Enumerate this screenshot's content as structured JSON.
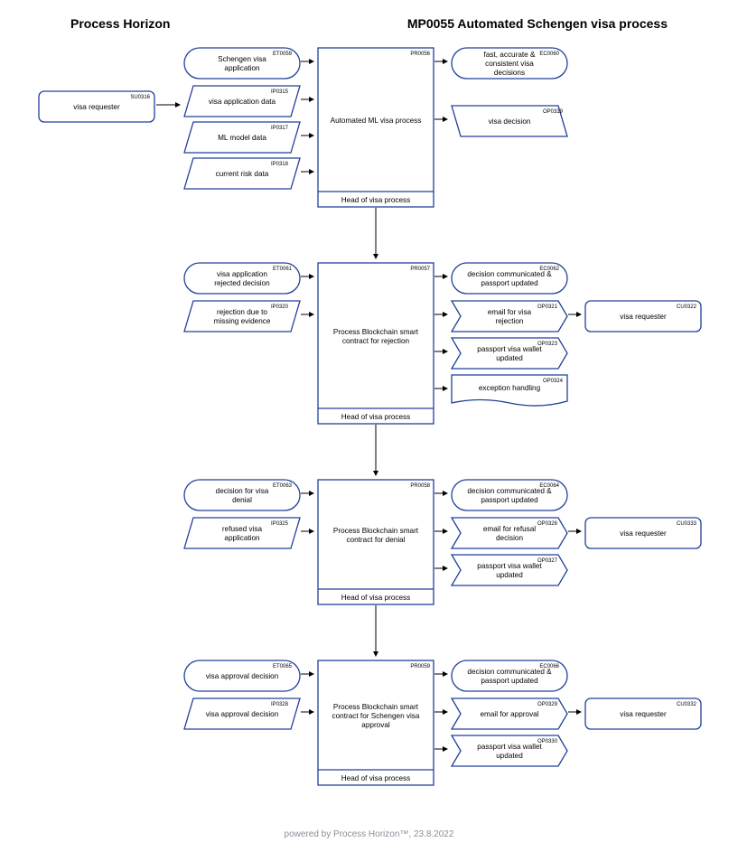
{
  "header": {
    "left": "Process Horizon",
    "right": "MP0055 Automated Schengen visa process"
  },
  "footer": "powered by Process Horizon™, 23.8.2022",
  "nodes": {
    "SU0316": {
      "code": "SU0316",
      "label": "visa requester"
    },
    "ET0059": {
      "code": "ET0059",
      "label": "Schengen visa application"
    },
    "IP0315": {
      "code": "IP0315",
      "label": "visa application data"
    },
    "IP0317": {
      "code": "IP0317",
      "label": "ML model data"
    },
    "IP0318": {
      "code": "IP0318",
      "label": "current risk data"
    },
    "PR0056": {
      "code": "PR0056",
      "label": "Automated ML visa process",
      "owner": "Head of visa process"
    },
    "EC0060": {
      "code": "EC0060",
      "label": "fast, accurate & consistent visa decisions"
    },
    "OP0319": {
      "code": "OP0319",
      "label": "visa decision"
    },
    "ET0061": {
      "code": "ET0061",
      "label": "visa application rejected decision"
    },
    "IP0320": {
      "code": "IP0320",
      "label": "rejection due to missing evidence"
    },
    "PR0057": {
      "code": "PR0057",
      "label": "Process Blockchain smart contract for rejection",
      "owner": "Head of visa process"
    },
    "EC0062": {
      "code": "EC0062",
      "label": "decision communicated & passport updated"
    },
    "OP0321": {
      "code": "OP0321",
      "label": "email for visa rejection"
    },
    "OP0323": {
      "code": "OP0323",
      "label": "passport visa wallet updated"
    },
    "OP0324": {
      "code": "OP0324",
      "label": "exception handling"
    },
    "CU0322": {
      "code": "CU0322",
      "label": "visa requester"
    },
    "ET0063": {
      "code": "ET0063",
      "label": "decision for visa denial"
    },
    "IP0325": {
      "code": "IP0325",
      "label": "refused visa application"
    },
    "PR0058": {
      "code": "PR0058",
      "label": "Process Blockchain smart contract for denial",
      "owner": "Head of visa process"
    },
    "EC0064": {
      "code": "EC0064",
      "label": "decision communicated & passport updated"
    },
    "OP0326": {
      "code": "OP0326",
      "label": "email for refusal decision"
    },
    "OP0327": {
      "code": "OP0327",
      "label": "passport visa wallet updated"
    },
    "CU0333": {
      "code": "CU0333",
      "label": "visa requester"
    },
    "ET0065": {
      "code": "ET0065",
      "label": "visa approval decision"
    },
    "IP0328": {
      "code": "IP0328",
      "label": "visa approval decision"
    },
    "PR0059": {
      "code": "PR0059",
      "label": "Process Blockchain smart contract for Schengen visa approval",
      "owner": "Head of visa process"
    },
    "EC0066": {
      "code": "EC0066",
      "label": "decision communicated & passport updated"
    },
    "OP0329": {
      "code": "OP0329",
      "label": "email for approval"
    },
    "OP0330": {
      "code": "OP0330",
      "label": "passport visa wallet updated"
    },
    "CU0332": {
      "code": "CU0332",
      "label": "visa requester"
    }
  }
}
